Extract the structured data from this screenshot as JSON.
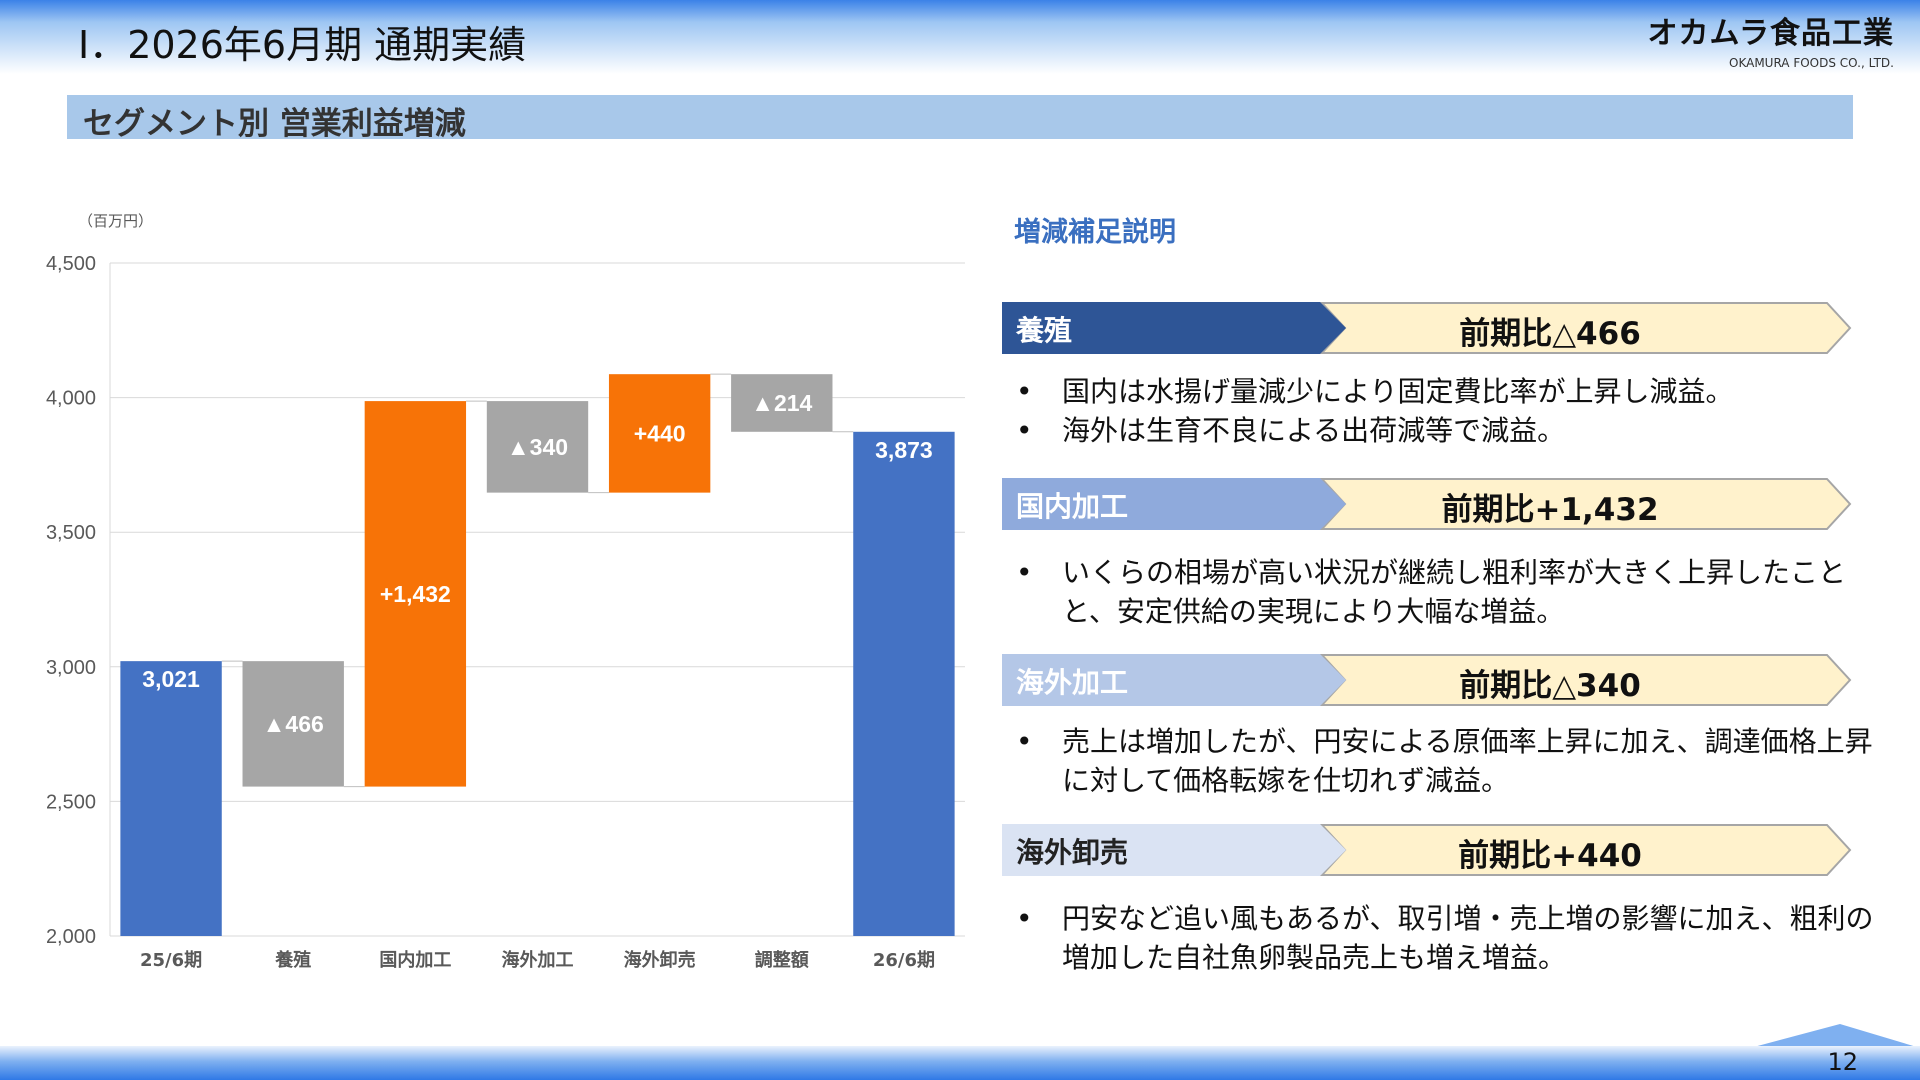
{
  "header": {
    "title": "Ⅰ．2026年6月期 通期実績",
    "logo_main": "オカムラ食品工業",
    "logo_sub": "OKAMURA FOODS CO., LTD."
  },
  "section_title": "セグメント別 営業利益増減",
  "chart_data": {
    "type": "waterfall",
    "unit_label": "（百万円）",
    "ylim": [
      2000,
      4500
    ],
    "yticks": [
      2000,
      2500,
      3000,
      3500,
      4000,
      4500
    ],
    "ytick_labels": [
      "2,000",
      "2,500",
      "3,000",
      "3,500",
      "4,000",
      "4,500"
    ],
    "grid": true,
    "bars": [
      {
        "category": "25/6期",
        "kind": "total",
        "start": 2000,
        "end": 3021,
        "label": "3,021",
        "color": "#4472c4"
      },
      {
        "category": "養殖",
        "kind": "decrease",
        "start": 3021,
        "end": 2555,
        "label": "▲466",
        "color": "#a6a6a6"
      },
      {
        "category": "国内加工",
        "kind": "increase",
        "start": 2555,
        "end": 3987,
        "label": "+1,432",
        "color": "#f77307"
      },
      {
        "category": "海外加工",
        "kind": "decrease",
        "start": 3987,
        "end": 3647,
        "label": "▲340",
        "color": "#a6a6a6"
      },
      {
        "category": "海外卸売",
        "kind": "increase",
        "start": 3647,
        "end": 4087,
        "label": "+440",
        "color": "#f77307"
      },
      {
        "category": "調整額",
        "kind": "decrease",
        "start": 4087,
        "end": 3873,
        "label": "▲214",
        "color": "#a6a6a6"
      },
      {
        "category": "26/6期",
        "kind": "total",
        "start": 2000,
        "end": 3873,
        "label": "3,873",
        "color": "#4472c4"
      }
    ]
  },
  "notes": {
    "title": "増減補足説明",
    "segments": [
      {
        "name": "養殖",
        "delta": "前期比△466",
        "color": "#2e5596",
        "name_color": "light",
        "bullets": [
          "国内は水揚げ量減少により固定費比率が上昇し減益。",
          "海外は生育不良による出荷減等で減益。"
        ]
      },
      {
        "name": "国内加工",
        "delta": "前期比+1,432",
        "color": "#8faadc",
        "name_color": "light",
        "bullets": [
          "いくらの相場が高い状況が継続し粗利率が大きく上昇したことと、安定供給の実現により大幅な増益。"
        ]
      },
      {
        "name": "海外加工",
        "delta": "前期比△340",
        "color": "#b4c7e7",
        "name_color": "light",
        "bullets": [
          "売上は増加したが、円安による原価率上昇に加え、調達価格上昇に対して価格転嫁を仕切れず減益。"
        ]
      },
      {
        "name": "海外卸売",
        "delta": "前期比+440",
        "color": "#dae3f3",
        "name_color": "dark",
        "bullets": [
          "円安など追い風もあるが、取引増・売上増の影響に加え、粗利の増加した自社魚卵製品売上も増え増益。"
        ]
      }
    ],
    "delta_fill": "#fff2cc"
  },
  "footer": {
    "page_number": "12"
  }
}
